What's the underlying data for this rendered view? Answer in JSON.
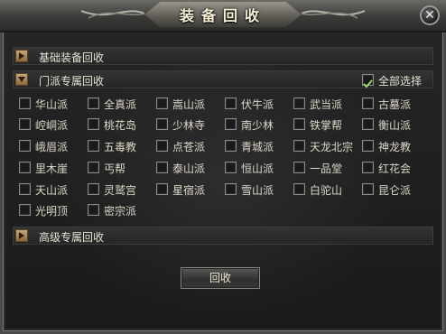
{
  "window": {
    "title": "装备回收",
    "close_label": "✕"
  },
  "sections": {
    "basic": {
      "label": "基础装备回收",
      "expanded": false
    },
    "sect": {
      "label": "门派专属回收",
      "expanded": true,
      "select_all_label": "全部选择",
      "select_all_checked": true
    },
    "advanced": {
      "label": "高级专属回收",
      "expanded": false
    }
  },
  "sect_items": [
    [
      "华山派",
      "全真派",
      "嵩山派",
      "伏牛派",
      "武当派",
      "古墓派"
    ],
    [
      "崆峒派",
      "桃花岛",
      "少林寺",
      "南少林",
      "铁掌帮",
      "衡山派"
    ],
    [
      "峨眉派",
      "五毒教",
      "点苍派",
      "青城派",
      "天龙北宗",
      "神龙教"
    ],
    [
      "里木崖",
      "丐帮",
      "泰山派",
      "恒山派",
      "一品堂",
      "红花会"
    ],
    [
      "天山派",
      "灵鹫宫",
      "星宿派",
      "雪山派",
      "白驼山",
      "昆仑派"
    ],
    [
      "光明顶",
      "密宗派"
    ]
  ],
  "buttons": {
    "recycle_label": "回收"
  }
}
